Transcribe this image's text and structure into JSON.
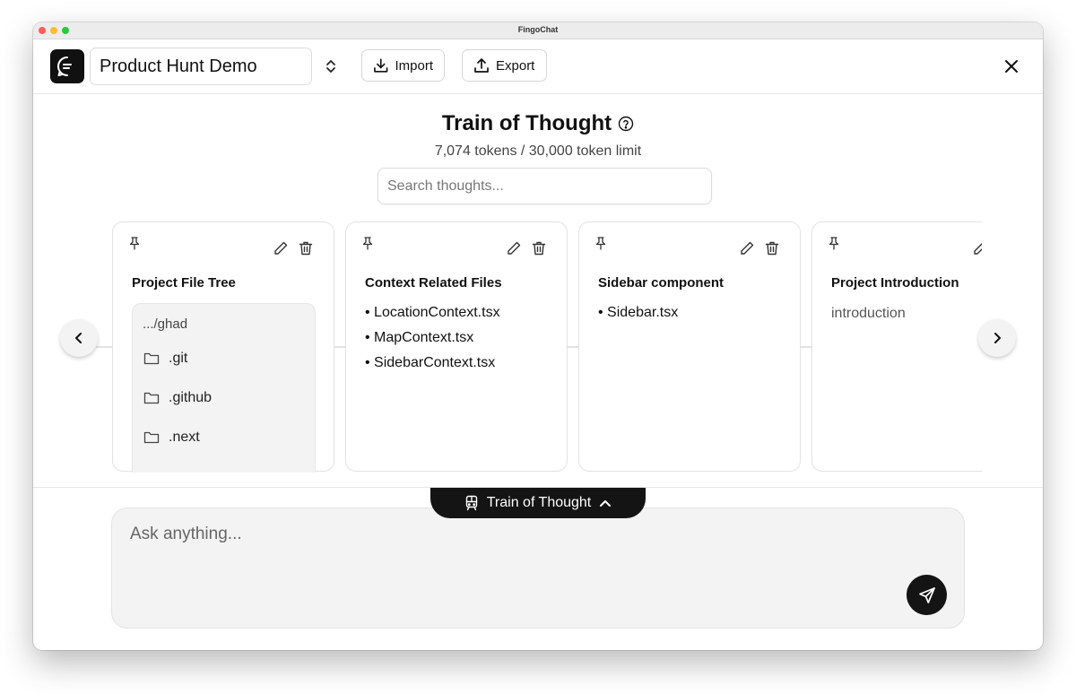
{
  "window": {
    "title": "FingoChat"
  },
  "header": {
    "project_name": "Product Hunt Demo",
    "import_label": "Import",
    "export_label": "Export"
  },
  "train": {
    "title": "Train of Thought",
    "tokens": "7,074 tokens / 30,000 token limit",
    "search_placeholder": "Search thoughts..."
  },
  "cards": [
    {
      "title": "Project File Tree",
      "path": ".../ghad",
      "folders": [
        ".git",
        ".github",
        ".next"
      ]
    },
    {
      "title": "Context Related Files",
      "items": [
        "LocationContext.tsx",
        "MapContext.tsx",
        "SidebarContext.tsx"
      ]
    },
    {
      "title": "Sidebar component",
      "items": [
        "Sidebar.tsx"
      ]
    },
    {
      "title": "Project Introduction",
      "text": "introduction"
    }
  ],
  "footer": {
    "toggle_label": "Train of Thought",
    "chat_placeholder": "Ask anything..."
  },
  "icons": {
    "logo": "chat-bubble-icon",
    "switcher": "chevron-up-down-icon",
    "import": "download-icon",
    "export": "upload-icon",
    "close": "close-icon",
    "help": "help-circle-icon",
    "pin": "pin-icon",
    "edit": "pencil-icon",
    "delete": "trash-icon",
    "folder": "folder-icon",
    "prev": "chevron-left-icon",
    "next": "chevron-right-icon",
    "train": "train-icon",
    "expand": "chevron-up-icon",
    "send": "send-icon"
  },
  "colors": {
    "primary": "#141414",
    "surface": "#f3f3f3",
    "border": "#e2e2e2"
  }
}
